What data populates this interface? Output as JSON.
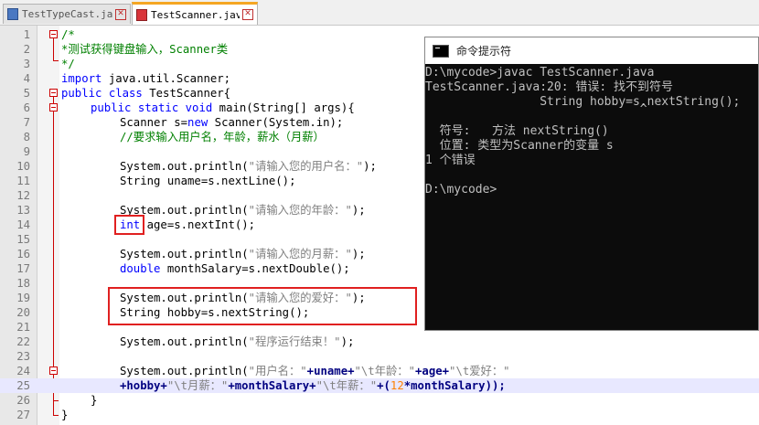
{
  "tabs": [
    {
      "label": "TestTypeCast.java",
      "active": false
    },
    {
      "label": "TestScanner.java",
      "active": true
    }
  ],
  "editor": {
    "line_numbers": [
      "1",
      "2",
      "3",
      "4",
      "5",
      "6",
      "7",
      "8",
      "9",
      "10",
      "11",
      "12",
      "13",
      "14",
      "15",
      "16",
      "17",
      "18",
      "19",
      "20",
      "21",
      "22",
      "23",
      "24",
      "25",
      "26",
      "27"
    ],
    "l1": "/*",
    "l2": "*测试获得键盘输入，Scanner类",
    "l3": "*/",
    "l4a": "import",
    "l4b": " java.util.Scanner;",
    "l5a": "public class",
    "l5b": " TestScanner{",
    "l6a": "public static void",
    "l6b": " main(String[] args){",
    "l7a": "Scanner s=",
    "l7b": "new",
    "l7c": " Scanner(System.in);",
    "l8": "//要求输入用户名，年龄，薪水（月薪）",
    "l10a": "System.out.println(",
    "l10b": "\"请输入您的用户名：\"",
    "l10c": ");",
    "l11": "String uname=s.nextLine();",
    "l13a": "System.out.println(",
    "l13b": "\"请输入您的年龄：\"",
    "l13c": ");",
    "l14a": "int",
    "l14b": " age=s.nextInt();",
    "l16a": "System.out.println(",
    "l16b": "\"请输入您的月薪：\"",
    "l16c": ");",
    "l17a": "double",
    "l17b": " monthSalary=s.nextDouble();",
    "l19a": "System.out.println(",
    "l19b": "\"请输入您的爱好：\"",
    "l19c": ");",
    "l20": "String hobby=s.nextString();",
    "l22a": "System.out.println(",
    "l22b": "\"程序运行结束！\"",
    "l22c": ");",
    "l24a": "System.out.println(",
    "l24b": "\"用户名：\"",
    "l24c": "+uname+",
    "l24d": "\"\\t年龄：\"",
    "l24e": "+age+",
    "l24f": "\"\\t爱好：\"",
    "l25a": "+hobby+",
    "l25b": "\"\\t月薪：\"",
    "l25c": "+monthSalary+",
    "l25d": "\"\\t年薪：\"",
    "l25e": "+(",
    "l25f": "12",
    "l25g": "*monthSalary));",
    "l26": "}",
    "l27": "}"
  },
  "cmd": {
    "title": "命令提示符",
    "lines": [
      "D:\\mycode>javac TestScanner.java",
      "TestScanner.java:20: 错误: 找不到符号",
      "                String hobby=s.nextString();",
      "                              ^",
      "",
      "  符号:   方法 nextString()",
      "  位置: 类型为Scanner的变量 s",
      "1 个错误",
      "",
      "D:\\mycode>"
    ]
  },
  "colors": {
    "keyword": "#0000ff",
    "comment": "#008000",
    "string": "#808080",
    "number": "#ff8000",
    "annotation_box": "#e02020",
    "current_line": "#e8e8ff"
  }
}
